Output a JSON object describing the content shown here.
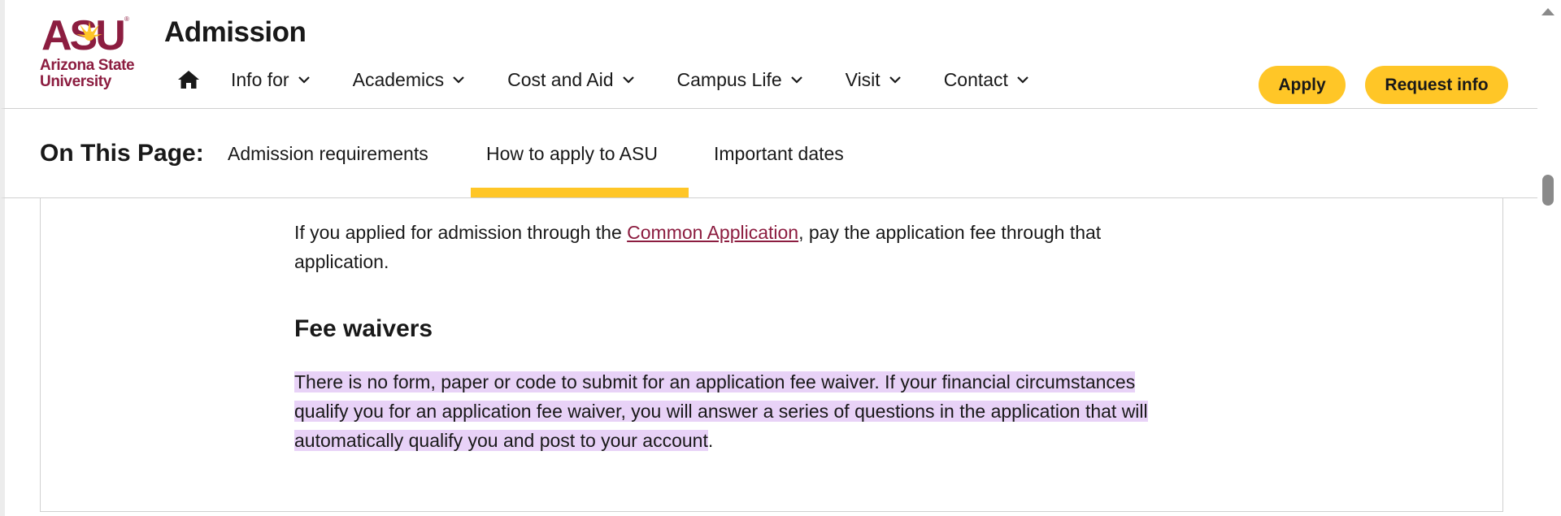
{
  "brand": {
    "logo_mark": "ASU",
    "logo_line1": "Arizona State",
    "logo_line2": "University",
    "color": "#8c1d40",
    "accent": "#ffc627"
  },
  "header": {
    "title": "Admission",
    "nav": [
      {
        "label": "Info for"
      },
      {
        "label": "Academics"
      },
      {
        "label": "Cost and Aid"
      },
      {
        "label": "Campus Life"
      },
      {
        "label": "Visit"
      },
      {
        "label": "Contact"
      }
    ],
    "apply_label": "Apply",
    "request_label": "Request info"
  },
  "on_this_page": {
    "title": "On This Page:",
    "links": [
      {
        "label": "Admission requirements"
      },
      {
        "label": "How to apply to ASU",
        "active": true
      },
      {
        "label": "Important dates"
      }
    ]
  },
  "content": {
    "para1_before": "If you applied for admission through the ",
    "para1_link": "Common Application",
    "para1_after": ", pay the application fee through that application.",
    "heading": "Fee waivers",
    "para2_highlighted": "There is no form, paper or code to submit for an application fee waiver. If your financial circumstances qualify you for an application fee waiver, you will answer a series of questions in the application that will automatically qualify you and post to your account",
    "para2_after": ".",
    "highlight_color": "#e8d2f7"
  },
  "icons": {
    "home": "home-icon",
    "chevron": "chevron-down-icon"
  }
}
